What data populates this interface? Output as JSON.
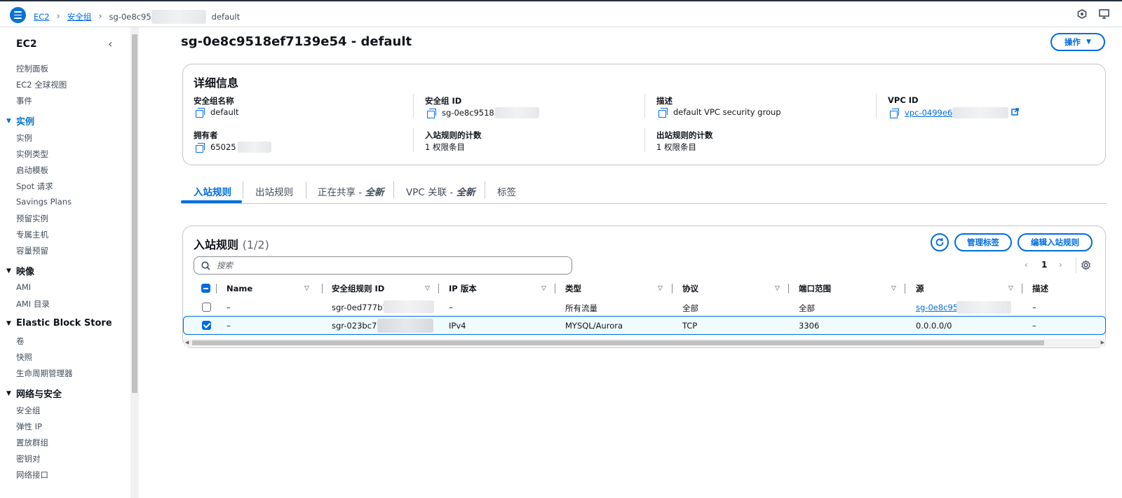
{
  "breadcrumb": {
    "items": [
      "EC2",
      "安全组"
    ],
    "current_prefix": "sg-0e8c95",
    "current_suffix": "default"
  },
  "sidebar": {
    "title": "EC2",
    "top_items": [
      "控制面板",
      "EC2 全球视图",
      "事件"
    ],
    "sections": [
      {
        "title": "实例",
        "items": [
          "实例",
          "实例类型",
          "启动模板",
          "Spot 请求",
          "Savings Plans",
          "预留实例",
          "专属主机",
          "容量预留"
        ]
      },
      {
        "title": "映像",
        "items": [
          "AMI",
          "AMI 目录"
        ]
      },
      {
        "title": "Elastic Block Store",
        "items": [
          "卷",
          "快照",
          "生命周期管理器"
        ]
      },
      {
        "title": "网络与安全",
        "items": [
          "安全组",
          "弹性 IP",
          "置放群组",
          "密钥对",
          "网络接口"
        ]
      }
    ]
  },
  "page": {
    "title": "sg-0e8c9518ef7139e54 - default",
    "actions_label": "操作"
  },
  "details": {
    "heading": "详细信息",
    "sg_name_label": "安全组名称",
    "sg_name": "default",
    "sg_id_label": "安全组 ID",
    "sg_id": "sg-0e8c9518",
    "desc_label": "描述",
    "desc": "default VPC security group",
    "vpc_label": "VPC ID",
    "vpc": "vpc-0499e6",
    "owner_label": "拥有者",
    "owner": "65025",
    "inbound_count_label": "入站规则的计数",
    "inbound_count": "1 权限条目",
    "outbound_count_label": "出站规则的计数",
    "outbound_count": "1 权限条目"
  },
  "tabs": {
    "inbound": "入站规则",
    "outbound": "出站规则",
    "sharing": "正在共享 - ",
    "sharing_new": "全新",
    "vpc_assoc": "VPC 关联 - ",
    "vpc_assoc_new": "全新",
    "tags": "标签"
  },
  "rules": {
    "heading": "入站规则",
    "count": "(1/2)",
    "manage_tags": "管理标签",
    "edit_inbound": "编辑入站规则",
    "search_placeholder": "搜索",
    "page_number": "1",
    "columns": [
      "Name",
      "安全组规则 ID",
      "IP 版本",
      "类型",
      "协议",
      "端口范围",
      "源",
      "描述"
    ],
    "rows": [
      {
        "name": "–",
        "rule_id": "sgr-0ed777b1",
        "ip_version": "–",
        "type": "所有流量",
        "protocol": "全部",
        "port": "全部",
        "source": "sg-0e8c95",
        "desc": "–",
        "selected": false
      },
      {
        "name": "–",
        "rule_id": "sgr-023bc79",
        "ip_version": "IPv4",
        "type": "MYSQL/Aurora",
        "protocol": "TCP",
        "port": "3306",
        "source": "0.0.0.0/0",
        "desc": "–",
        "selected": true
      }
    ]
  }
}
